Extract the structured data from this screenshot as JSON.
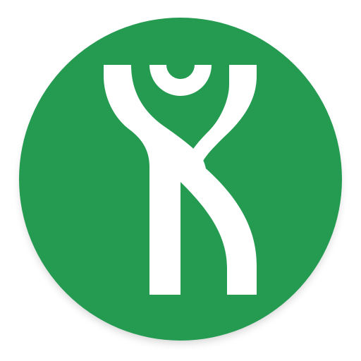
{
  "icon": {
    "name": "person-arms-raised-icon",
    "colors": {
      "background_circle": "#259b52",
      "figure": "#ffffff",
      "shadow": "#000000"
    }
  }
}
